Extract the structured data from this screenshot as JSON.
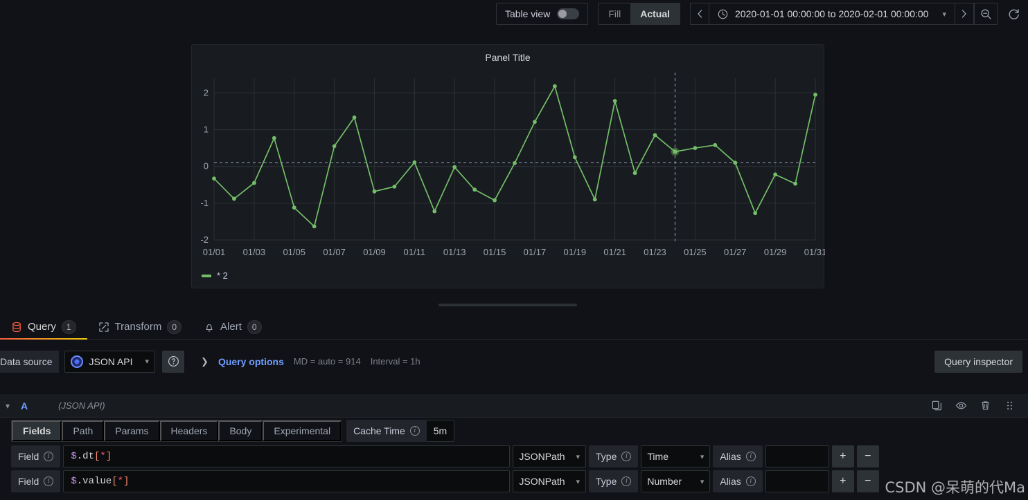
{
  "toolbar": {
    "table_view_label": "Table view",
    "table_view_on": false,
    "fill_label": "Fill",
    "actual_label": "Actual",
    "time_range": "2020-01-01 00:00:00 to 2020-02-01 00:00:00",
    "prev_icon": "chevron-left-icon",
    "next_icon": "chevron-right-icon",
    "clock_icon": "clock-icon",
    "zoom_out_icon": "zoom-out-icon",
    "refresh_icon": "refresh-icon"
  },
  "panel": {
    "title": "Panel Title",
    "legend_label": "* 2"
  },
  "chart_data": {
    "type": "line",
    "title": "Panel Title",
    "xlabel": "",
    "ylabel": "",
    "ylim": [
      -2,
      2.4
    ],
    "yticks": [
      2,
      1,
      0,
      -1,
      -2
    ],
    "grid": true,
    "legend_position": "bottom-left",
    "series_color": "#73bf69",
    "threshold_line": 0.1,
    "crosshair_x": "01/24",
    "x": [
      "01/01",
      "01/02",
      "01/03",
      "01/04",
      "01/05",
      "01/06",
      "01/07",
      "01/08",
      "01/09",
      "01/10",
      "01/11",
      "01/12",
      "01/13",
      "01/14",
      "01/15",
      "01/16",
      "01/17",
      "01/18",
      "01/19",
      "01/20",
      "01/21",
      "01/22",
      "01/23",
      "01/24",
      "01/25",
      "01/26",
      "01/27",
      "01/28",
      "01/29",
      "01/30",
      "01/31"
    ],
    "xticks": [
      "01/01",
      "01/03",
      "01/05",
      "01/07",
      "01/09",
      "01/11",
      "01/13",
      "01/15",
      "01/17",
      "01/19",
      "01/21",
      "01/23",
      "01/25",
      "01/27",
      "01/29",
      "01/31"
    ],
    "series": [
      {
        "name": "* 2",
        "values": [
          -0.33,
          -0.88,
          -0.45,
          0.77,
          -1.12,
          -1.63,
          0.55,
          1.33,
          -0.68,
          -0.55,
          0.11,
          -1.22,
          -0.02,
          -0.63,
          -0.92,
          0.09,
          1.21,
          2.18,
          0.25,
          -0.9,
          1.78,
          -0.18,
          0.85,
          0.4,
          0.5,
          0.58,
          0.1,
          -1.27,
          -0.22,
          -0.47,
          1.95
        ]
      }
    ]
  },
  "tabs": [
    {
      "label": "Query",
      "count": "1",
      "icon": "database-icon",
      "active": true
    },
    {
      "label": "Transform",
      "count": "0",
      "icon": "transform-icon",
      "active": false
    },
    {
      "label": "Alert",
      "count": "0",
      "icon": "bell-icon",
      "active": false
    }
  ],
  "datasource_row": {
    "label": "Data source",
    "value": "JSON API",
    "help_icon": "help-circle-icon",
    "query_options_label": "Query options",
    "md_text": "MD = auto = 914",
    "interval_text": "Interval = 1h",
    "query_inspector_label": "Query inspector"
  },
  "query": {
    "ref_id": "A",
    "datasource_note": "(JSON API)",
    "actions": [
      {
        "name": "duplicate-query-icon"
      },
      {
        "name": "toggle-visibility-icon"
      },
      {
        "name": "delete-query-icon"
      },
      {
        "name": "drag-handle-icon"
      }
    ],
    "subtabs": [
      {
        "label": "Fields",
        "active": true
      },
      {
        "label": "Path",
        "active": false
      },
      {
        "label": "Params",
        "active": false
      },
      {
        "label": "Headers",
        "active": false
      },
      {
        "label": "Body",
        "active": false
      },
      {
        "label": "Experimental",
        "active": false
      }
    ],
    "cache_time_label": "Cache Time",
    "cache_time_value": "5m",
    "fields": [
      {
        "label": "Field",
        "expr_dollar": "$",
        "expr_name": ".dt",
        "expr_open": "[",
        "expr_star": "*",
        "expr_close": "]",
        "jsonpath_label": "JSONPath",
        "type_label": "Type",
        "type_value": "Time",
        "alias_label": "Alias",
        "alias_value": ""
      },
      {
        "label": "Field",
        "expr_dollar": "$",
        "expr_name": ".value",
        "expr_open": "[",
        "expr_star": "*",
        "expr_close": "]",
        "jsonpath_label": "JSONPath",
        "type_label": "Type",
        "type_value": "Number",
        "alias_label": "Alias",
        "alias_value": ""
      }
    ],
    "add_field_label": "+",
    "remove_field_label": "−"
  },
  "watermark": "CSDN @呆萌的代Ma"
}
